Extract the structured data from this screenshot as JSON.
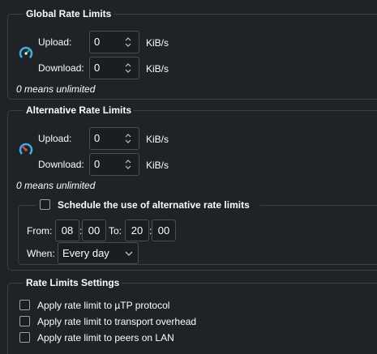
{
  "global": {
    "title": "Global Rate Limits",
    "upload_label": "Upload:",
    "upload_value": "0",
    "upload_unit": "KiB/s",
    "download_label": "Download:",
    "download_value": "0",
    "download_unit": "KiB/s",
    "hint": "0 means unlimited"
  },
  "alternative": {
    "title": "Alternative Rate Limits",
    "upload_label": "Upload:",
    "upload_value": "0",
    "upload_unit": "KiB/s",
    "download_label": "Download:",
    "download_value": "0",
    "download_unit": "KiB/s",
    "hint": "0 means unlimited",
    "schedule": {
      "checkbox_label": "Schedule the use of alternative rate limits",
      "checked": false,
      "from_label": "From:",
      "from_hour": "08",
      "from_minute": "00",
      "to_label": "To:",
      "to_hour": "20",
      "to_minute": "00",
      "time_separator": ":",
      "when_label": "When:",
      "when_value": "Every day"
    }
  },
  "settings": {
    "title": "Rate Limits Settings",
    "options": [
      {
        "label": "Apply rate limit to µTP protocol",
        "checked": false
      },
      {
        "label": "Apply rate limit to transport overhead",
        "checked": false
      },
      {
        "label": "Apply rate limit to peers on LAN",
        "checked": false
      }
    ]
  },
  "colors": {
    "background": "#202326",
    "text": "#fcfcfc",
    "border": "#3b3e42",
    "gauge_normal": "#3daee9",
    "gauge_alt": "#da4453"
  },
  "icons": {
    "global": "speedometer-icon",
    "alternative": "speedometer-alt-icon"
  }
}
